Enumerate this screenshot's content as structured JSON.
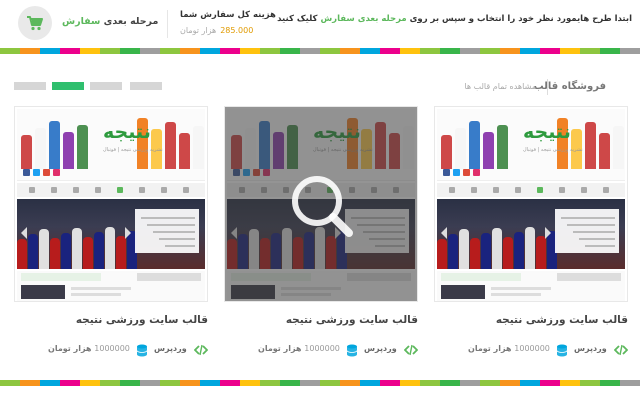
{
  "colors": {
    "accent": "#5cb85c",
    "price": "#e09a00",
    "stripe": [
      "#8dc63f",
      "#f7941d",
      "#00a6de",
      "#ec008c",
      "#ffc20e",
      "#8dc63f",
      "#39b54a",
      "#9e9e9e"
    ]
  },
  "topbar": {
    "instruction_prefix": "ابتدا طرح هایمورد نظر خود را انتخاب و سپس بر روی",
    "instruction_link": "مرحله بعدی سفارش",
    "instruction_suffix": "کلیک کنید",
    "total_label": "هزینه کل سفارش شما",
    "total_price": "285.000",
    "total_unit": "هزار تومان",
    "next_step_prefix": "مرحله بعدی",
    "next_step_highlight": "سفارش",
    "cart_icon": "cart-icon"
  },
  "section": {
    "title": "فروشگاه قالب",
    "view_all": "مشاهده تمام قالب ها",
    "pager_count": 4,
    "pager_active": 1
  },
  "products": [
    {
      "title": "قالب سایت ورزشی نتیجه",
      "logo": "نتیجه",
      "logo_sub": "نشریه ورزشی نتیجه | فوتبال",
      "price": "1000000",
      "unit": "هزار تومان",
      "platform": "وردپرس",
      "hover": false
    },
    {
      "title": "قالب سایت ورزشی نتیجه",
      "logo": "نتیجه",
      "logo_sub": "نشریه ورزشی نتیجه | فوتبال",
      "price": "1000000",
      "unit": "هزار تومان",
      "platform": "وردپرس",
      "hover": true
    },
    {
      "title": "قالب سایت ورزشی نتیجه",
      "logo": "نتیجه",
      "logo_sub": "نشریه ورزشی نتیجه | فوتبال",
      "price": "1000000",
      "unit": "هزار تومان",
      "platform": "وردپرس",
      "hover": false
    }
  ]
}
